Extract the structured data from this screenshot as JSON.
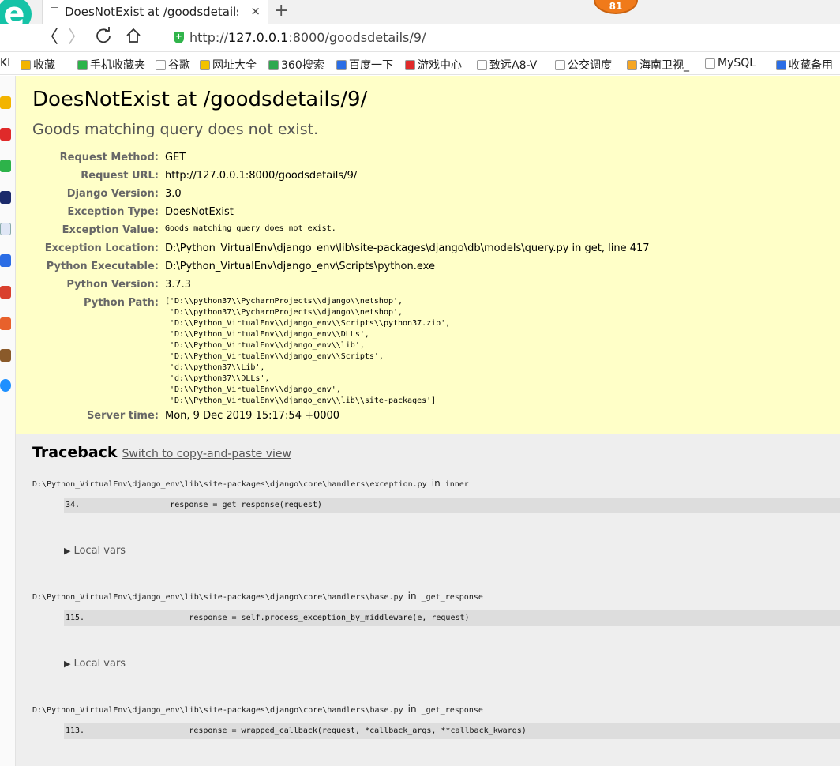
{
  "browser": {
    "logo_letter": "e",
    "tab_title": "DoesNotExist at /goodsdetails/9/",
    "tab_close": "×",
    "new_tab": "+",
    "notification_count": "81",
    "back": "〈",
    "forward": "〉",
    "url_prefix": "http://",
    "url_host": "127.0.0.1",
    "url_rest": ":8000/goodsdetails/9/",
    "bookmarks": [
      {
        "label": "收藏",
        "color": "#f3b400"
      },
      {
        "label": "手机收藏夹",
        "color": "#2db34a"
      },
      {
        "label": "谷歌",
        "color": "#ffffff"
      },
      {
        "label": "网址大全",
        "color": "#f2c200"
      },
      {
        "label": "360搜索",
        "color": "#2fa84f"
      },
      {
        "label": "百度一下",
        "color": "#2b6de5"
      },
      {
        "label": "游戏中心",
        "color": "#e02a2a"
      },
      {
        "label": "致远A8-V",
        "color": "#ffffff"
      },
      {
        "label": "公交调度",
        "color": "#ffffff"
      },
      {
        "label": "海南卫视_",
        "color": "#f5a623"
      },
      {
        "label": "MySQL",
        "color": "#ffffff"
      },
      {
        "label": "收藏备用",
        "color": "#2b6de5"
      }
    ],
    "bookmark_left_stub": "KI"
  },
  "error": {
    "title": "DoesNotExist at /goodsdetails/9/",
    "message": "Goods matching query does not exist.",
    "meta": [
      {
        "key": "Request Method:",
        "value": "GET"
      },
      {
        "key": "Request URL:",
        "value": "http://127.0.0.1:8000/goodsdetails/9/"
      },
      {
        "key": "Django Version:",
        "value": "3.0"
      },
      {
        "key": "Exception Type:",
        "value": "DoesNotExist"
      },
      {
        "key": "Exception Value:",
        "value": "Goods matching query does not exist."
      },
      {
        "key": "Exception Location:",
        "value": "D:\\Python_VirtualEnv\\django_env\\lib\\site-packages\\django\\db\\models\\query.py in get, line 417"
      },
      {
        "key": "Python Executable:",
        "value": "D:\\Python_VirtualEnv\\django_env\\Scripts\\python.exe"
      },
      {
        "key": "Python Version:",
        "value": "3.7.3"
      },
      {
        "key": "Python Path:",
        "value": "['D:\\\\python37\\\\PycharmProjects\\\\django\\\\netshop',\n 'D:\\\\python37\\\\PycharmProjects\\\\django\\\\netshop',\n 'D:\\\\Python_VirtualEnv\\\\django_env\\\\Scripts\\\\python37.zip',\n 'D:\\\\Python_VirtualEnv\\\\django_env\\\\DLLs',\n 'D:\\\\Python_VirtualEnv\\\\django_env\\\\lib',\n 'D:\\\\Python_VirtualEnv\\\\django_env\\\\Scripts',\n 'd:\\\\python37\\\\Lib',\n 'd:\\\\python37\\\\DLLs',\n 'D:\\\\Python_VirtualEnv\\\\django_env',\n 'D:\\\\Python_VirtualEnv\\\\django_env\\\\lib\\\\site-packages']"
      },
      {
        "key": "Server time:",
        "value": "Mon, 9 Dec 2019 15:17:54 +0000"
      }
    ]
  },
  "traceback": {
    "heading": "Traceback",
    "switch_link": "Switch to copy-and-paste view",
    "in_word": "in",
    "local_vars": "Local vars",
    "frames": [
      {
        "path": "D:\\Python_VirtualEnv\\django_env\\lib\\site-packages\\django\\core\\handlers\\exception.py",
        "func": "inner",
        "line": "34.",
        "code": "            response = get_response(request)"
      },
      {
        "path": "D:\\Python_VirtualEnv\\django_env\\lib\\site-packages\\django\\core\\handlers\\base.py",
        "func": "_get_response",
        "line": "115.",
        "code": "                response = self.process_exception_by_middleware(e, request)"
      },
      {
        "path": "D:\\Python_VirtualEnv\\django_env\\lib\\site-packages\\django\\core\\handlers\\base.py",
        "func": "_get_response",
        "line": "113.",
        "code": "                response = wrapped_callback(request, *callback_args, **callback_kwargs)"
      }
    ]
  }
}
